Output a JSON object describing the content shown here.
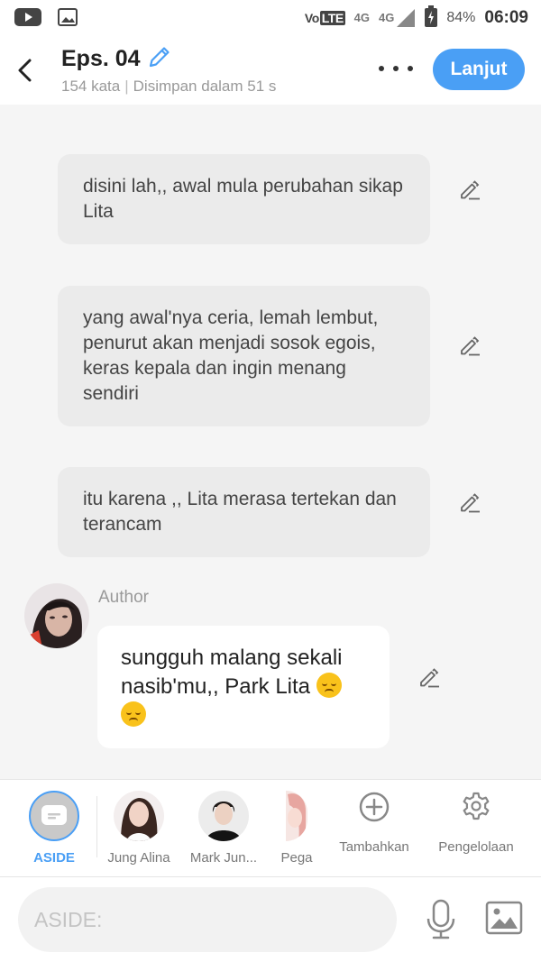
{
  "status_bar": {
    "volte": "Vo",
    "volte_box": "LTE",
    "net1": "4G",
    "net2": "4G",
    "battery": "84%",
    "time": "06:09"
  },
  "header": {
    "episode_title": "Eps. 04",
    "word_count": "154 kata",
    "separator": "|",
    "saved_status": "Disimpan dalam 51 s",
    "next_label": "Lanjut"
  },
  "messages": [
    {
      "text": "disini lah,, awal mula perubahan sikap Lita"
    },
    {
      "text": "yang awal'nya ceria, lemah lembut, penurut akan menjadi sosok egois, keras kepala dan ingin menang sendiri"
    },
    {
      "text": "itu karena ,, Lita merasa tertekan dan terancam"
    }
  ],
  "author_message": {
    "name": "Author",
    "text": "sungguh malang sekali nasib'mu,, Park Lita",
    "emoji": [
      "pensive-face",
      "pensive-face"
    ]
  },
  "characters": [
    {
      "label": "ASIDE"
    },
    {
      "label": "Jung Alina"
    },
    {
      "label": "Mark Jun..."
    },
    {
      "label": "Pega"
    }
  ],
  "tools": {
    "add_label": "Tambahkan",
    "manage_label": "Pengelolaan"
  },
  "input": {
    "placeholder": "ASIDE:"
  },
  "colors": {
    "accent": "#4a9ff5",
    "aside_bubble": "#ebebeb",
    "author_bubble": "#ffffff",
    "background": "#f5f5f5"
  }
}
